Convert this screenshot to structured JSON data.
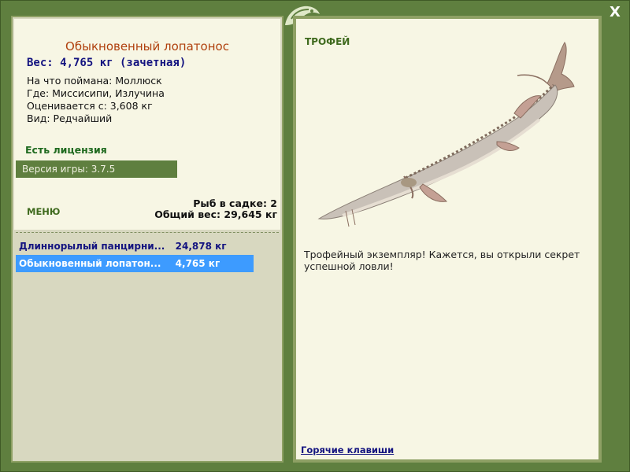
{
  "window": {
    "close_label": "X"
  },
  "fish": {
    "name": "Обыкновенный лопатонос",
    "weight_line": "Вес: 4,765 кг (зачетная)",
    "details": [
      "На что поймана: Моллюск",
      "Где: Миссисипи, Излучина",
      "Оценивается с: 3,608 кг",
      "Вид: Редчайший"
    ]
  },
  "license": "Есть лицензия",
  "version": "Версия игры: 3.7.5",
  "menu_label": "МЕНЮ",
  "stats": {
    "fish_count": "Рыб в садке: 2",
    "total_weight": "Общий вес: 29,645 кг"
  },
  "fish_list": [
    {
      "name": "Длиннорылый панцирни...",
      "weight": "24,878 кг",
      "selected": false
    },
    {
      "name": "Обыкновенный лопатон...",
      "weight": "4,765 кг",
      "selected": true
    }
  ],
  "trophy": {
    "label": "ТРОФЕЙ",
    "description": "Трофейный экземпляр! Кажется, вы открыли секрет успешной ловли!"
  },
  "hotkeys_label": "Горячие клавиши",
  "colors": {
    "frame": "#5f7f3f",
    "title": "#b0410e",
    "accent_text": "#141480",
    "selection": "#3d9bff"
  }
}
